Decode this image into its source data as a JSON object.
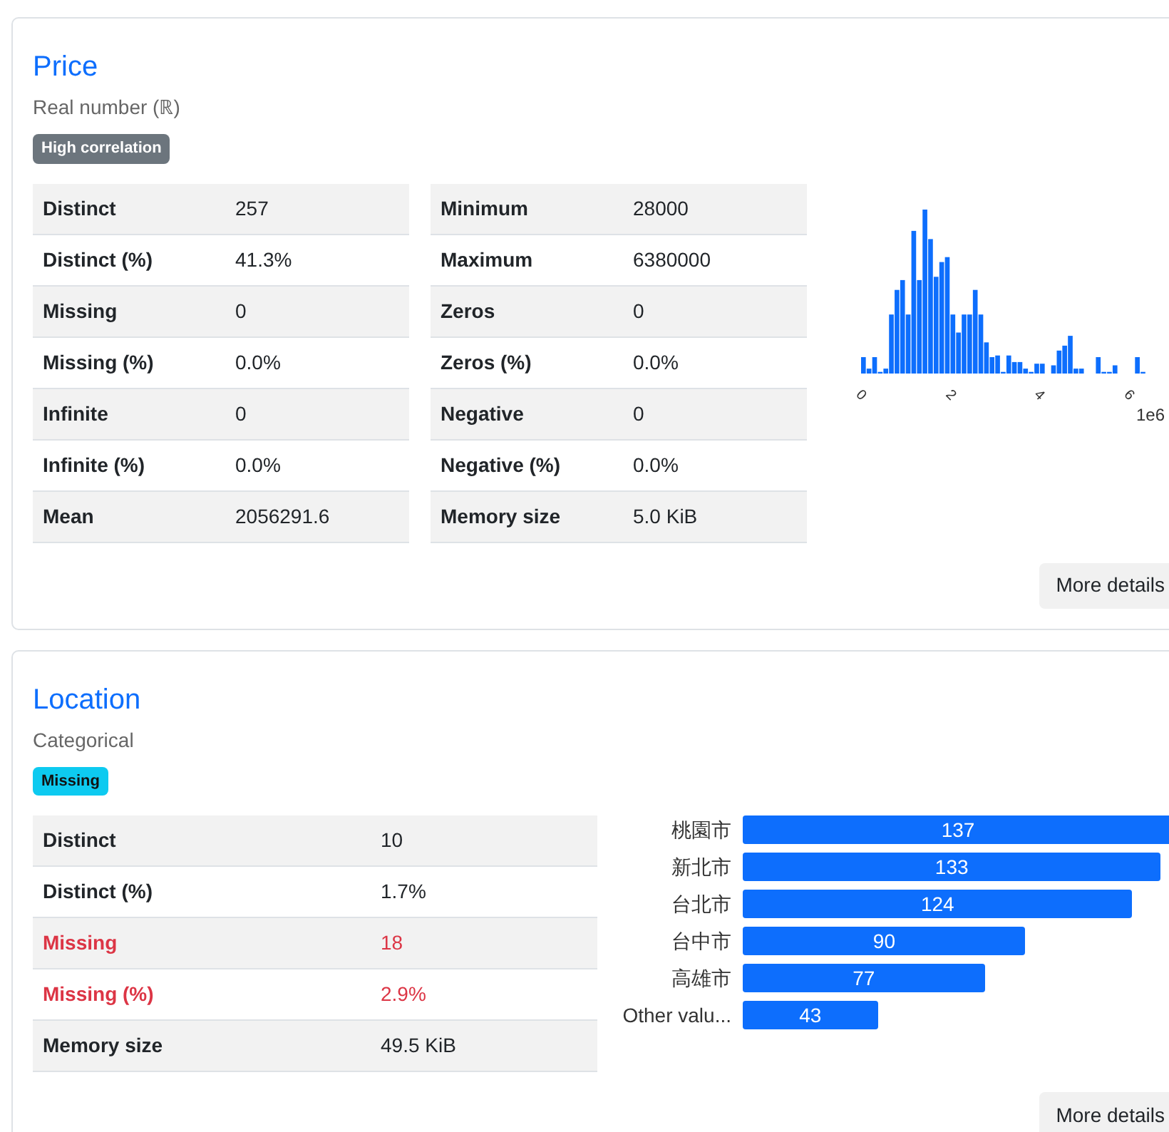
{
  "variables": [
    {
      "title": "Price",
      "subtitle": "Real number (ℝ)",
      "badges": [
        {
          "label": "High correlation",
          "kind": "secondary"
        }
      ],
      "tables": [
        [
          {
            "label": "Distinct",
            "value": "257",
            "alert": false
          },
          {
            "label": "Distinct (%)",
            "value": "41.3%",
            "alert": false
          },
          {
            "label": "Missing",
            "value": "0",
            "alert": false
          },
          {
            "label": "Missing (%)",
            "value": "0.0%",
            "alert": false
          },
          {
            "label": "Infinite",
            "value": "0",
            "alert": false
          },
          {
            "label": "Infinite (%)",
            "value": "0.0%",
            "alert": false
          },
          {
            "label": "Mean",
            "value": "2056291.6",
            "alert": false
          }
        ],
        [
          {
            "label": "Minimum",
            "value": "28000",
            "alert": false
          },
          {
            "label": "Maximum",
            "value": "6380000",
            "alert": false
          },
          {
            "label": "Zeros",
            "value": "0",
            "alert": false
          },
          {
            "label": "Zeros (%)",
            "value": "0.0%",
            "alert": false
          },
          {
            "label": "Negative",
            "value": "0",
            "alert": false
          },
          {
            "label": "Negative (%)",
            "value": "0.0%",
            "alert": false
          },
          {
            "label": "Memory size",
            "value": "5.0 KiB",
            "alert": false
          }
        ]
      ],
      "visual": {
        "kind": "histogram",
        "tick_labels": [
          "0",
          "2",
          "4",
          "6"
        ],
        "scale_label": "1e6"
      },
      "button": "More details"
    },
    {
      "title": "Location",
      "subtitle": "Categorical",
      "badges": [
        {
          "label": "Missing",
          "kind": "info"
        }
      ],
      "tables": [
        [
          {
            "label": "Distinct",
            "value": "10",
            "alert": false
          },
          {
            "label": "Distinct (%)",
            "value": "1.7%",
            "alert": false
          },
          {
            "label": "Missing",
            "value": "18",
            "alert": true
          },
          {
            "label": "Missing (%)",
            "value": "2.9%",
            "alert": true
          },
          {
            "label": "Memory size",
            "value": "49.5 KiB",
            "alert": false
          }
        ]
      ],
      "visual": {
        "kind": "bars",
        "chart_data": {
          "type": "bar",
          "orientation": "horizontal",
          "categories": [
            "桃園市",
            "新北市",
            "台北市",
            "台中市",
            "高雄市",
            "Other valu..."
          ],
          "series": [
            {
              "color": "#0d6efd",
              "values": [
                137,
                133,
                124,
                90,
                77,
                43
              ]
            }
          ],
          "data_labels": true
        }
      },
      "button": "More details"
    }
  ]
}
